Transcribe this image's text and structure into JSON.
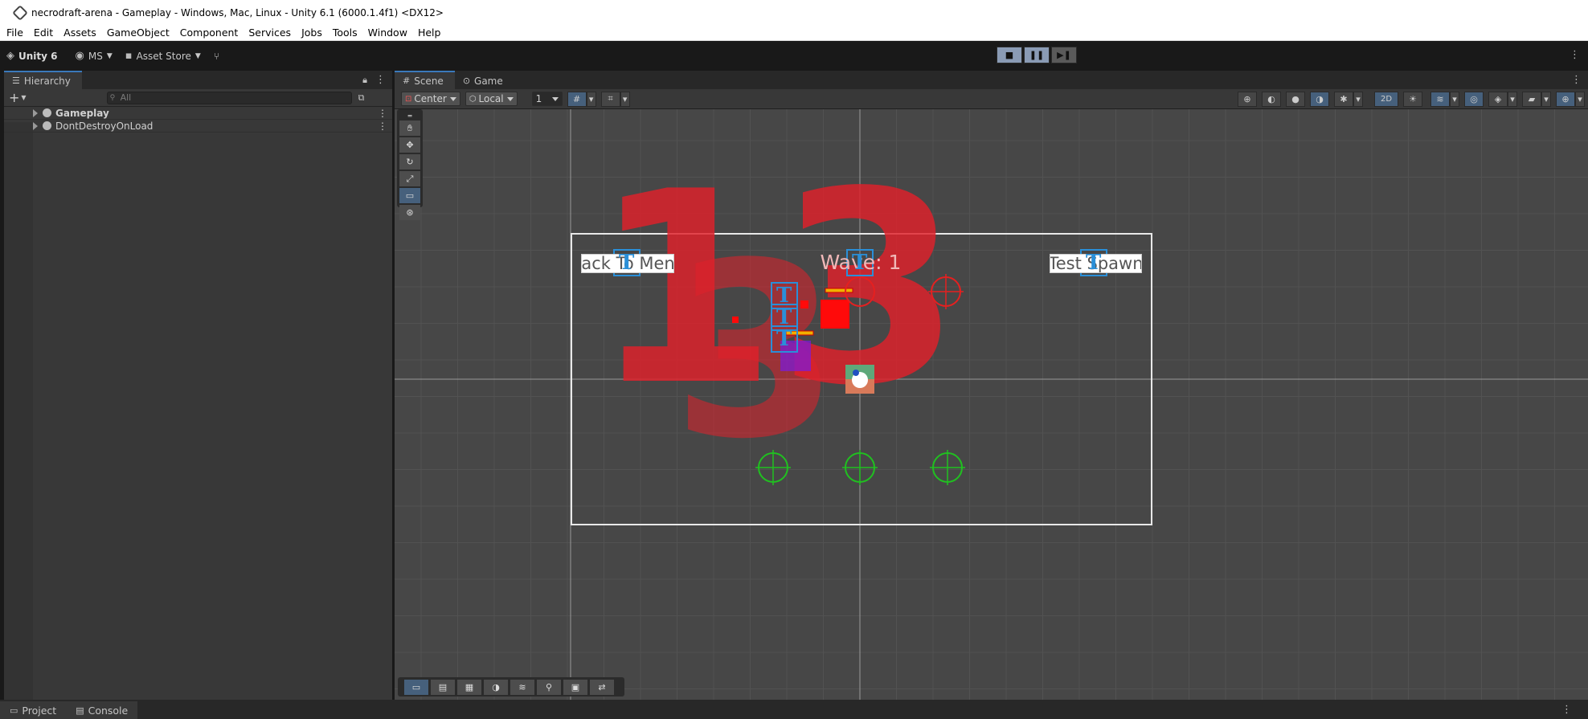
{
  "window": {
    "title": "necrodraft-arena - Gameplay - Windows, Mac, Linux - Unity 6.1 (6000.1.4f1) <DX12>"
  },
  "menu": [
    "File",
    "Edit",
    "Assets",
    "GameObject",
    "Component",
    "Services",
    "Jobs",
    "Tools",
    "Window",
    "Help"
  ],
  "toolbar": {
    "unity": "Unity 6",
    "account": "MS",
    "asset_store": "Asset Store"
  },
  "hierarchy": {
    "tab": "Hierarchy",
    "search_placeholder": "All",
    "items": [
      {
        "label": "Gameplay"
      },
      {
        "label": "DontDestroyOnLoad"
      }
    ]
  },
  "scene": {
    "tabs": [
      {
        "label": "Scene"
      },
      {
        "label": "Game"
      }
    ],
    "pivot": "Center",
    "space": "Local",
    "grid_snap": "1",
    "mode_2d": "2D",
    "ui": {
      "back_button": "Back To Menu",
      "wave_label": "Wave: 1",
      "spawn_button": "Test Spawn",
      "big_numbers": "13"
    }
  },
  "bottom": {
    "tabs": [
      {
        "label": "Project"
      },
      {
        "label": "Console"
      }
    ]
  },
  "colors": {
    "accent": "#3a79bb",
    "selected": "#46607c",
    "enemy_red": "#e0202a",
    "spawn_green": "#20c020"
  }
}
